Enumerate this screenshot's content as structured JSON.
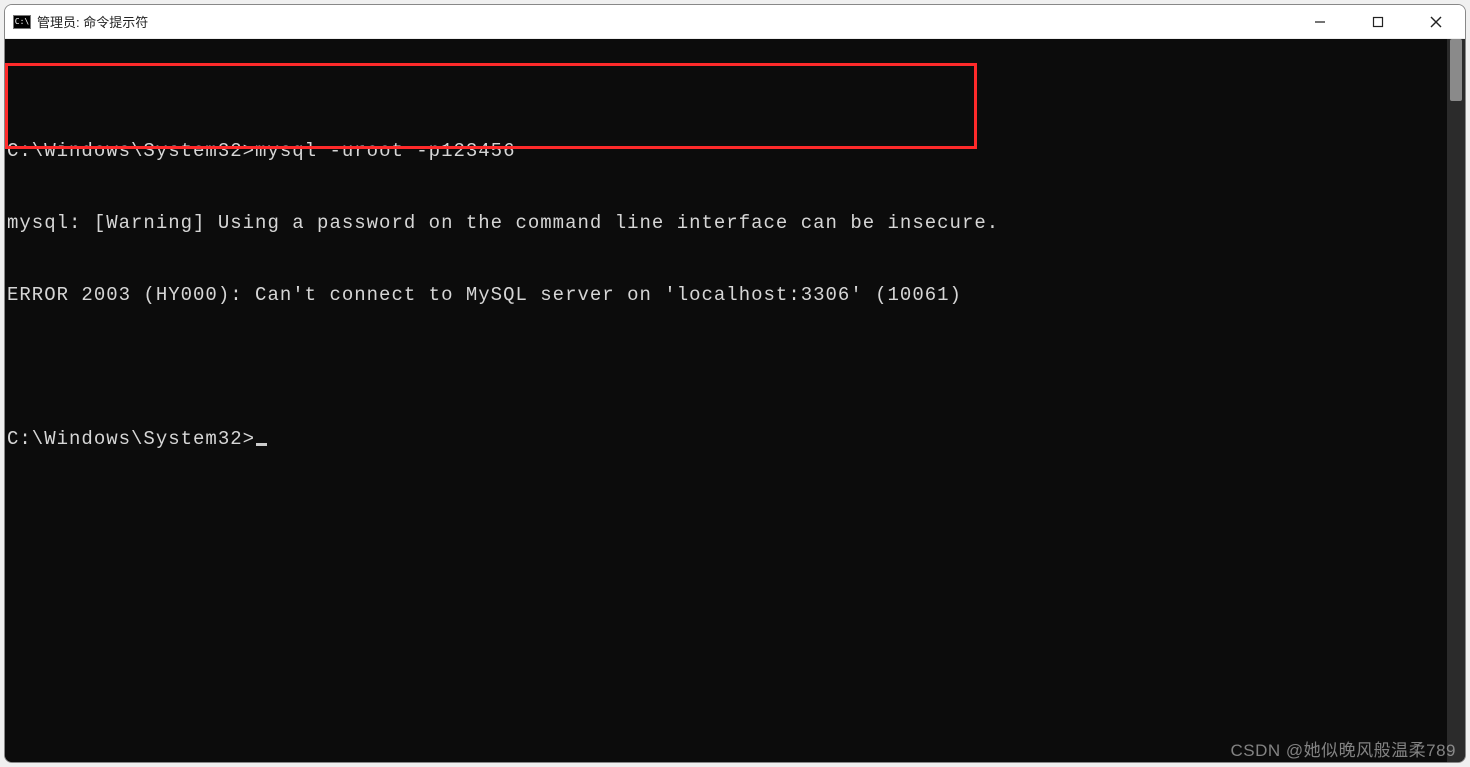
{
  "window": {
    "title": "管理员: 命令提示符",
    "icon_label": "C:\\"
  },
  "terminal": {
    "prompt1_path": "C:\\Windows\\System32>",
    "prompt1_cmd": "mysql -uroot -p123456",
    "warning_line": "mysql: [Warning] Using a password on the command line interface can be insecure.",
    "error_line": "ERROR 2003 (HY000): Can't connect to MySQL server on 'localhost:3306' (10061)",
    "prompt2_path": "C:\\Windows\\System32>"
  },
  "watermark": "CSDN @她似晚风般温柔789",
  "colors": {
    "highlight_border": "#ff2a2a",
    "terminal_bg": "#0c0c0c",
    "terminal_fg": "#cccccc"
  }
}
